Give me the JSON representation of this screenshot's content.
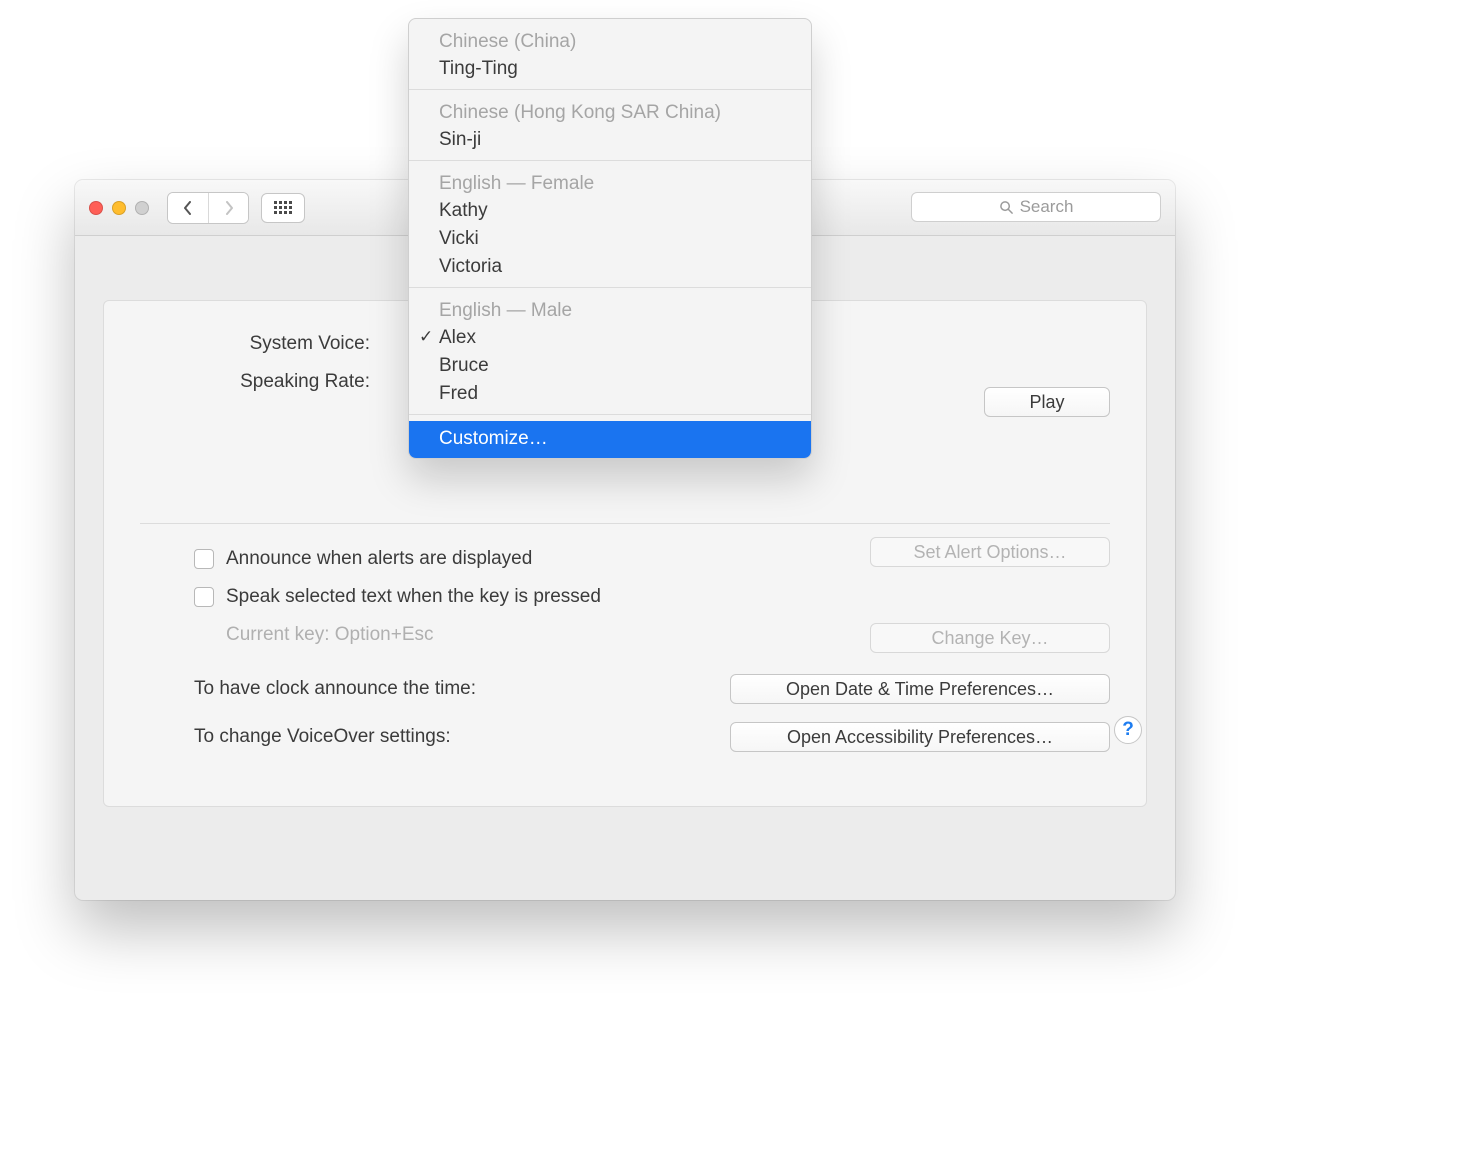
{
  "titlebar": {
    "search_placeholder": "Search"
  },
  "panel": {
    "system_voice_label": "System Voice:",
    "speaking_rate_label": "Speaking Rate:",
    "play_label": "Play",
    "announce_alerts_label": "Announce when alerts are displayed",
    "set_alert_options_label": "Set Alert Options…",
    "speak_selected_label": "Speak selected text when the key is pressed",
    "current_key_label": "Current key: Option+Esc",
    "change_key_label": "Change Key…",
    "clock_label": "To have clock announce the time:",
    "open_datetime_label": "Open Date & Time Preferences…",
    "voiceover_label": "To change VoiceOver settings:",
    "open_accessibility_label": "Open Accessibility Preferences…",
    "help_label": "?"
  },
  "dropdown": {
    "groups": [
      {
        "header": "Chinese (China)",
        "items": [
          "Ting-Ting"
        ]
      },
      {
        "header": "Chinese (Hong Kong SAR China)",
        "items": [
          "Sin-ji"
        ]
      },
      {
        "header": "English — Female",
        "items": [
          "Kathy",
          "Vicki",
          "Victoria"
        ]
      },
      {
        "header": "English — Male",
        "items": [
          "Alex",
          "Bruce",
          "Fred"
        ]
      }
    ],
    "checked_item": "Alex",
    "customize_label": "Customize…"
  }
}
